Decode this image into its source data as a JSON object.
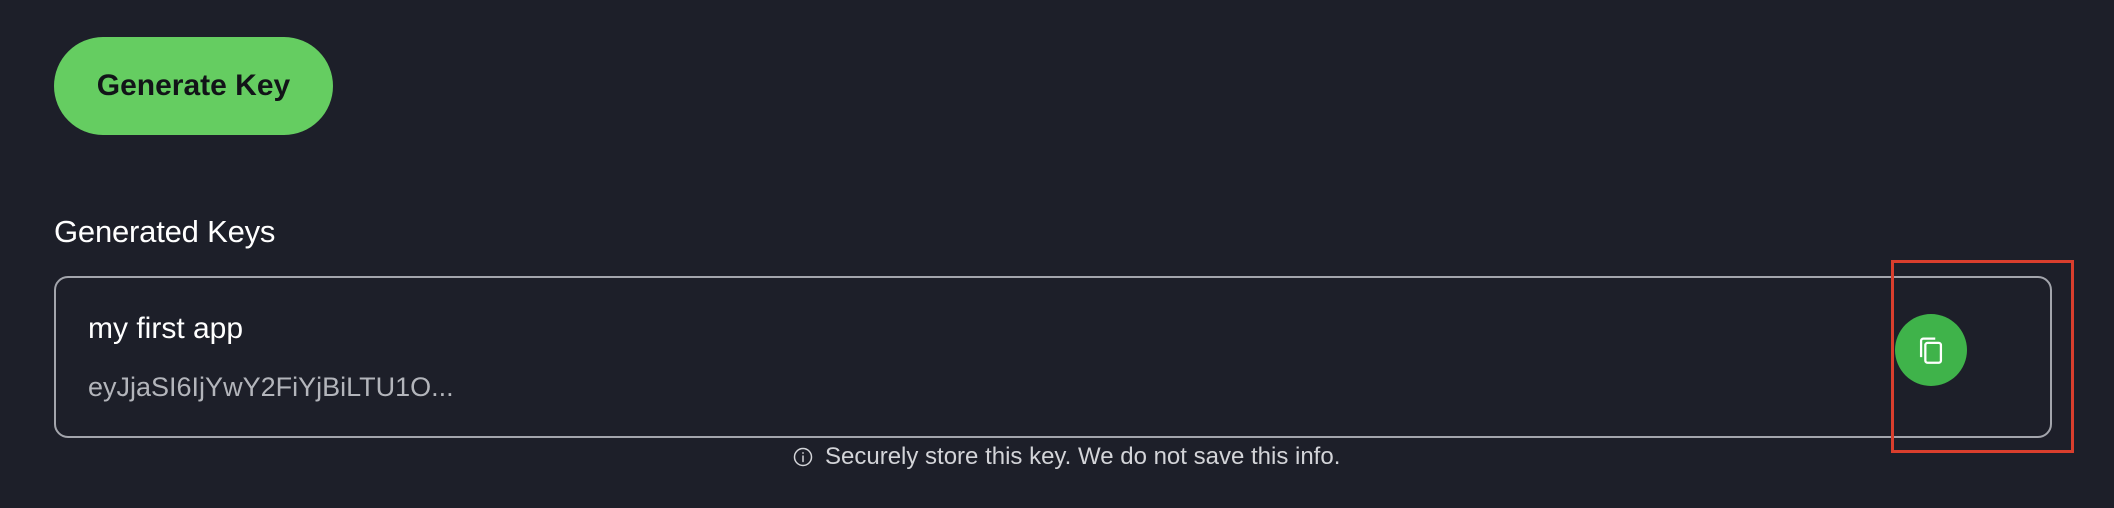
{
  "actions": {
    "generate_label": "Generate Key"
  },
  "keys_section": {
    "title": "Generated Keys",
    "items": [
      {
        "name": "my first app",
        "value": "eyJjaSI6IjYwY2FiYjBiLTU1O..."
      }
    ]
  },
  "notice": {
    "text": "Securely store this key. We do not save this info.",
    "icon": "info-icon"
  },
  "icons": {
    "copy": "copy-icon"
  },
  "colors": {
    "background": "#1d1f29",
    "primary": "#65cd61",
    "copy_button": "#3fb34a",
    "card_border": "#a3a5ac",
    "highlight": "#d93e2d"
  }
}
